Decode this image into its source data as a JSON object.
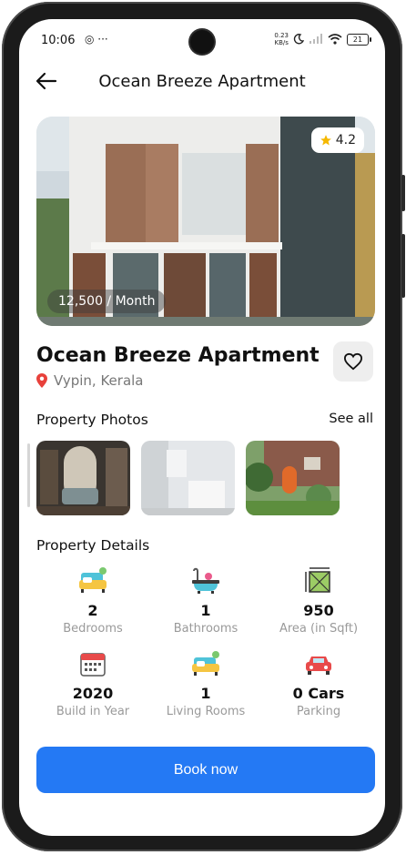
{
  "status_bar": {
    "time": "10:06",
    "notification_icons": "◎ ···",
    "speed_value": "0.23",
    "speed_unit": "KB/s",
    "battery": "21"
  },
  "header": {
    "title": "Ocean Breeze Apartment",
    "back_icon": "arrow-left-icon"
  },
  "hero": {
    "rating": "4.2",
    "price": "12,500 / Month",
    "star_color": "#f5b800"
  },
  "property": {
    "name": "Ocean Breeze Apartment",
    "location": "Vypin, Kerala",
    "pin_color": "#e8413b"
  },
  "photos": {
    "title": "Property Photos",
    "see_all": "See all"
  },
  "details": {
    "title": "Property Details",
    "items": [
      {
        "value": "2",
        "label": "Bedrooms",
        "icon": "sofa-icon"
      },
      {
        "value": "1",
        "label": "Bathrooms",
        "icon": "bathtub-icon"
      },
      {
        "value": "950",
        "label": "Area (in Sqft)",
        "icon": "area-icon"
      },
      {
        "value": "2020",
        "label": "Build in Year",
        "icon": "calendar-icon"
      },
      {
        "value": "1",
        "label": "Living Rooms",
        "icon": "couch-icon"
      },
      {
        "value": "0 Cars",
        "label": "Parking",
        "icon": "car-icon"
      }
    ]
  },
  "cta": {
    "book_label": "Book now",
    "color": "#2479f4"
  }
}
